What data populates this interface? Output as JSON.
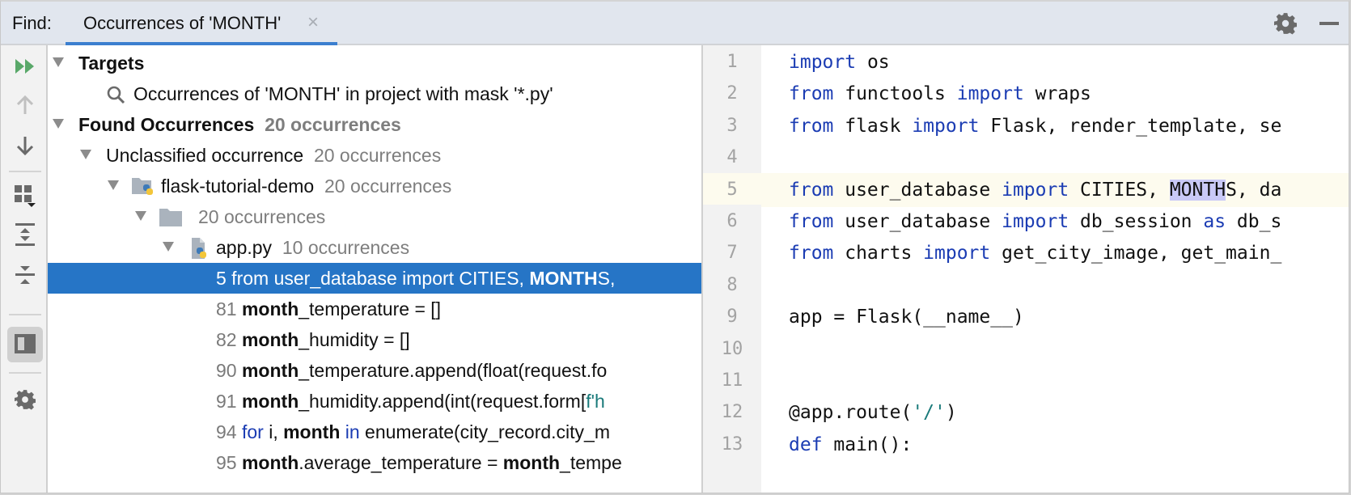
{
  "header": {
    "find_label": "Find:",
    "tab_label": "Occurrences of 'MONTH'",
    "tab_close_icon": "×",
    "accent": "#3b7fcf"
  },
  "toolbar": {
    "buttons": [
      "rerun-icon",
      "previous-occurrence-icon",
      "next-occurrence-icon",
      "group-by-icon",
      "expand-all-icon",
      "collapse-all-icon",
      "preview-toggle-icon",
      "settings-icon"
    ]
  },
  "tree": {
    "targets": {
      "label": "Targets"
    },
    "target_item": {
      "label": "Occurrences of 'MONTH' in project with mask '*.py'"
    },
    "found": {
      "label": "Found Occurrences",
      "count": "20 occurrences"
    },
    "unclassified": {
      "label": "Unclassified occurrence",
      "count": "20 occurrences"
    },
    "project": {
      "label": "flask-tutorial-demo",
      "count": "20 occurrences"
    },
    "folder": {
      "label": "",
      "count": "20 occurrences"
    },
    "file": {
      "label": "app.py",
      "count": "10 occurrences"
    },
    "results": [
      {
        "line": "5",
        "pre": " from user_database import CITIES, ",
        "match": "MONTH",
        "post": "S,",
        "selected": true
      },
      {
        "line": "81",
        "pre": " ",
        "match": "month",
        "post": "_temperature = []"
      },
      {
        "line": "82",
        "pre": " ",
        "match": "month",
        "post": "_humidity = []"
      },
      {
        "line": "90",
        "pre": " ",
        "match": "month",
        "post": "_temperature.append(float(request.fo"
      },
      {
        "line": "91",
        "pre": " ",
        "match": "month",
        "post": "_humidity.append(int(request.form[",
        "tail_str": "f'h"
      },
      {
        "line": "94",
        "kw1": "for",
        "mid1": " i, ",
        "match": "month",
        "kw2": "in",
        "post": " enumerate(city_record.city_m"
      },
      {
        "line": "95",
        "pre": " ",
        "match": "month",
        "post": ".average_temperature = ",
        "match2": "month",
        "post2": "_tempe"
      }
    ],
    "selected_color": "#2675c6"
  },
  "editor": {
    "current_line": 5,
    "lines": [
      {
        "n": "1",
        "parts": [
          [
            "kw",
            "import"
          ],
          [
            "t",
            " os"
          ]
        ]
      },
      {
        "n": "2",
        "parts": [
          [
            "kw",
            "from"
          ],
          [
            "t",
            " functools "
          ],
          [
            "kw",
            "import"
          ],
          [
            "t",
            " wraps"
          ]
        ]
      },
      {
        "n": "3",
        "parts": [
          [
            "kw",
            "from"
          ],
          [
            "t",
            " flask "
          ],
          [
            "kw",
            "import"
          ],
          [
            "t",
            " Flask, render_template, se"
          ]
        ]
      },
      {
        "n": "4",
        "parts": []
      },
      {
        "n": "5",
        "parts": [
          [
            "kw",
            "from"
          ],
          [
            "t",
            " user_database "
          ],
          [
            "kw",
            "import"
          ],
          [
            "t",
            " CITIES, "
          ],
          [
            "hl",
            "MONTH"
          ],
          [
            "t",
            "S, da"
          ]
        ]
      },
      {
        "n": "6",
        "parts": [
          [
            "kw",
            "from"
          ],
          [
            "t",
            " user_database "
          ],
          [
            "kw",
            "import"
          ],
          [
            "t",
            " db_session "
          ],
          [
            "kw",
            "as"
          ],
          [
            "t",
            " db_s"
          ]
        ]
      },
      {
        "n": "7",
        "parts": [
          [
            "kw",
            "from"
          ],
          [
            "t",
            " charts "
          ],
          [
            "kw",
            "import"
          ],
          [
            "t",
            " get_city_image, get_main_"
          ]
        ]
      },
      {
        "n": "8",
        "parts": []
      },
      {
        "n": "9",
        "parts": [
          [
            "t",
            "app = Flask(__name__)"
          ]
        ]
      },
      {
        "n": "10",
        "parts": []
      },
      {
        "n": "11",
        "parts": []
      },
      {
        "n": "12",
        "parts": [
          [
            "t",
            "@app.route("
          ],
          [
            "str",
            "'/'"
          ],
          [
            "t",
            ")"
          ]
        ]
      },
      {
        "n": "13",
        "parts": [
          [
            "kw",
            "def"
          ],
          [
            "t",
            " main():"
          ]
        ]
      }
    ],
    "keyword_color": "#1b3cb3",
    "string_color": "#1a7a7a",
    "highlight_color": "#c9c9f7"
  }
}
